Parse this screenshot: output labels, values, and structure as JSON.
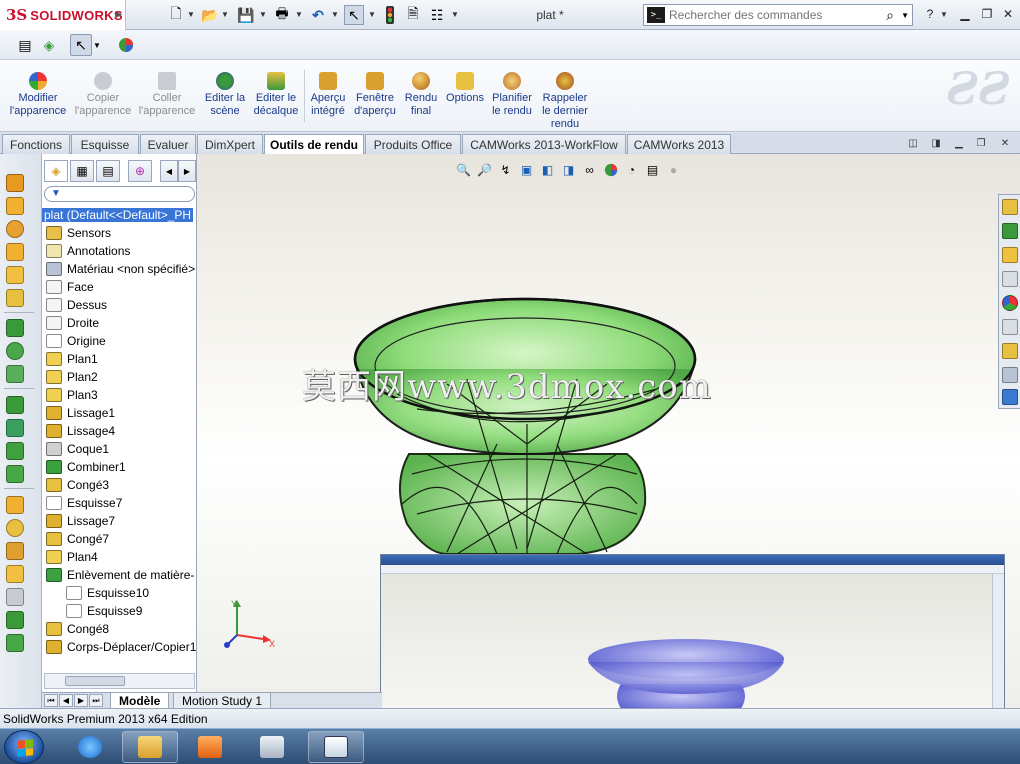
{
  "app": {
    "logo_prefix": "3S",
    "logo_text": "SOLIDWORKS",
    "document_title": "plat *"
  },
  "search": {
    "placeholder": "Rechercher des commandes"
  },
  "ribbon": {
    "buttons": [
      {
        "label": "Modifier l'apparence",
        "enabled": true,
        "icon": "appearance-icon"
      },
      {
        "label": "Copier l'apparence",
        "enabled": false,
        "icon": "copy-appearance-icon"
      },
      {
        "label": "Coller l'apparence",
        "enabled": false,
        "icon": "paste-appearance-icon"
      },
      {
        "label": "Editer la scène",
        "enabled": true,
        "icon": "scene-icon"
      },
      {
        "label": "Editer le décalque",
        "enabled": true,
        "icon": "decal-icon"
      },
      {
        "label": "Aperçu intégré",
        "enabled": true,
        "icon": "integrated-preview-icon"
      },
      {
        "label": "Fenêtre d'aperçu",
        "enabled": true,
        "icon": "preview-window-icon"
      },
      {
        "label": "Rendu final",
        "enabled": true,
        "icon": "final-render-icon"
      },
      {
        "label": "Options",
        "enabled": true,
        "icon": "options-icon"
      },
      {
        "label": "Planifier le rendu",
        "enabled": true,
        "icon": "schedule-render-icon"
      },
      {
        "label": "Rappeler le dernier rendu",
        "enabled": true,
        "icon": "recall-render-icon"
      }
    ]
  },
  "tabs": [
    {
      "label": "Fonctions",
      "active": false
    },
    {
      "label": "Esquisse",
      "active": false
    },
    {
      "label": "Evaluer",
      "active": false
    },
    {
      "label": "DimXpert",
      "active": false
    },
    {
      "label": "Outils de rendu",
      "active": true
    },
    {
      "label": "Produits Office",
      "active": false
    },
    {
      "label": "CAMWorks 2013-WorkFlow",
      "active": false
    },
    {
      "label": "CAMWorks 2013",
      "active": false
    }
  ],
  "tree": {
    "root": "plat  (Default<<Default>_PH",
    "items": [
      {
        "label": "Sensors",
        "icon": "sensors-icon",
        "color": "#e8c04a"
      },
      {
        "label": "Annotations",
        "icon": "annotations-icon",
        "color": "#f2e6b0"
      },
      {
        "label": "Matériau <non spécifié>",
        "icon": "material-icon",
        "color": "#b8c4d6"
      },
      {
        "label": "Face",
        "icon": "plane-icon",
        "color": "#f4f4f4"
      },
      {
        "label": "Dessus",
        "icon": "plane-icon",
        "color": "#f4f4f4"
      },
      {
        "label": "Droite",
        "icon": "plane-icon",
        "color": "#f4f4f4"
      },
      {
        "label": "Origine",
        "icon": "origin-icon",
        "color": "#ffffff"
      },
      {
        "label": "Plan1",
        "icon": "plane-icon",
        "color": "#f0d050"
      },
      {
        "label": "Plan2",
        "icon": "plane-icon",
        "color": "#f0d050"
      },
      {
        "label": "Plan3",
        "icon": "plane-icon",
        "color": "#f0d050"
      },
      {
        "label": "Lissage1",
        "icon": "loft-icon",
        "color": "#e0b030"
      },
      {
        "label": "Lissage4",
        "icon": "loft-icon",
        "color": "#e0b030"
      },
      {
        "label": "Coque1",
        "icon": "shell-icon",
        "color": "#d0d0d0"
      },
      {
        "label": "Combiner1",
        "icon": "combine-icon",
        "color": "#3aa040"
      },
      {
        "label": "Congé3",
        "icon": "fillet-icon",
        "color": "#e8c040"
      },
      {
        "label": "Esquisse7",
        "icon": "sketch-icon",
        "color": "#ffffff"
      },
      {
        "label": "Lissage7",
        "icon": "loft-icon",
        "color": "#e0b030"
      },
      {
        "label": "Congé7",
        "icon": "fillet-icon",
        "color": "#e8c040"
      },
      {
        "label": "Plan4",
        "icon": "plane-icon",
        "color": "#f0d050"
      },
      {
        "label": "Enlèvement de matière-",
        "icon": "cut-icon",
        "color": "#3aa040"
      },
      {
        "label": "Esquisse10",
        "icon": "sketch-icon",
        "color": "#ffffff",
        "child": true
      },
      {
        "label": "Esquisse9",
        "icon": "sketch-icon",
        "color": "#ffffff",
        "child": true
      },
      {
        "label": "Congé8",
        "icon": "fillet-icon",
        "color": "#e8c040"
      },
      {
        "label": "Corps-Déplacer/Copier1",
        "icon": "move-body-icon",
        "color": "#e0b030"
      }
    ]
  },
  "bottom_tabs": [
    {
      "label": "Modèle",
      "active": true
    },
    {
      "label": "Motion Study 1",
      "active": false
    }
  ],
  "status": {
    "text": "SolidWorks Premium 2013 x64 Edition"
  },
  "watermark": {
    "text": "莫西网www.3dmox.com"
  },
  "colors": {
    "model_fill": "#8fdc7a",
    "inset_model": "#6f72d8",
    "accent": "#c8102e"
  }
}
